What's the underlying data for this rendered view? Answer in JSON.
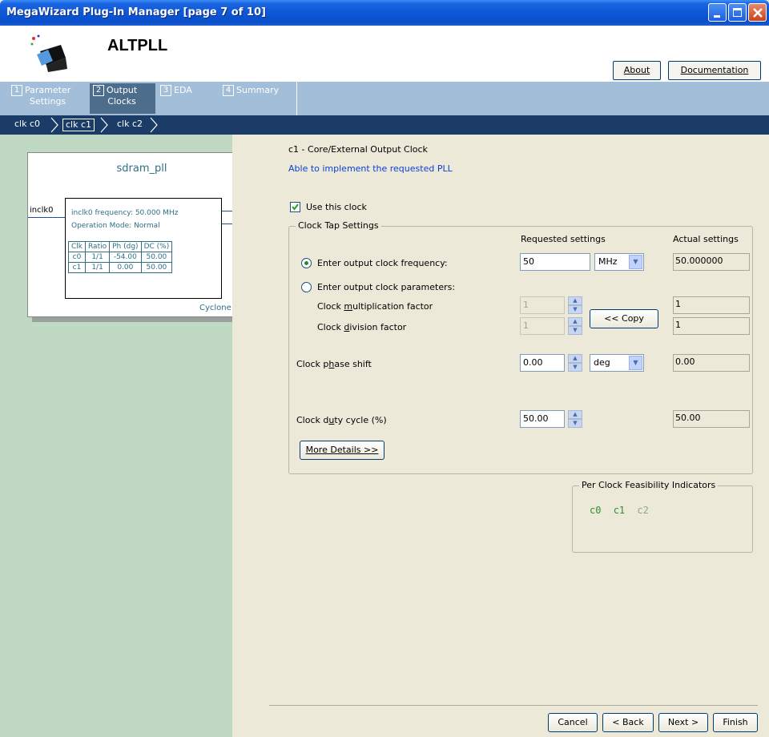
{
  "window": {
    "title": "MegaWizard Plug-In Manager [page 7 of 10]"
  },
  "header": {
    "app_name": "ALTPLL",
    "about_label": "About",
    "documentation_label": "Documentation"
  },
  "steps": [
    {
      "num": "1",
      "label_line1": "Parameter",
      "label_line2": "Settings"
    },
    {
      "num": "2",
      "label_line1": "Output",
      "label_line2": "Clocks"
    },
    {
      "num": "3",
      "label_line1": "EDA",
      "label_line2": ""
    },
    {
      "num": "4",
      "label_line1": "Summary",
      "label_line2": ""
    }
  ],
  "breadcrumbs": [
    "clk c0",
    "clk c1",
    "clk c2"
  ],
  "diagram": {
    "title": "sdram_pll",
    "input_pin": "inclk0",
    "freq_text": "inclk0 frequency: 50.000 MHz",
    "mode_text": "Operation Mode: Normal",
    "out_c0": "c0",
    "out_c1": "c1",
    "device": "Cyclone II",
    "table_headers": [
      "Clk",
      "Ratio",
      "Ph (dg)",
      "DC (%)"
    ],
    "table_rows": [
      [
        "c0",
        "1/1",
        "-54.00",
        "50.00"
      ],
      [
        "c1",
        "1/1",
        "0.00",
        "50.00"
      ]
    ]
  },
  "content": {
    "heading": "c1 - Core/External Output Clock",
    "subheading": "Able to implement the requested PLL",
    "use_clock_label": "Use this clock",
    "use_clock_checked": true,
    "group_title": "Clock Tap Settings",
    "requested_header": "Requested settings",
    "actual_header": "Actual settings",
    "freq_option_label": "Enter output clock frequency:",
    "freq_value": "50",
    "freq_unit": "MHz",
    "freq_actual": "50.000000",
    "params_option_label": "Enter output clock parameters:",
    "mult_label": "Clock multiplication factor",
    "mult_value": "1",
    "mult_actual": "1",
    "div_label": "Clock division factor",
    "div_value": "1",
    "div_actual": "1",
    "copy_label": "<< Copy",
    "phase_label": "Clock phase shift",
    "phase_value": "0.00",
    "phase_unit": "deg",
    "phase_actual": "0.00",
    "duty_label": "Clock duty cycle (%)",
    "duty_value": "50.00",
    "duty_actual": "50.00",
    "more_details_label": "More Details >>",
    "feasibility_title": "Per Clock Feasibility Indicators",
    "feasibility": [
      {
        "name": "c0",
        "color": "#2f8f2f"
      },
      {
        "name": "c1",
        "color": "#2f8f2f"
      },
      {
        "name": "c2",
        "color": "#8aa88a"
      }
    ]
  },
  "footer": {
    "cancel": "Cancel",
    "back": "< Back",
    "next": "Next >",
    "finish": "Finish"
  }
}
